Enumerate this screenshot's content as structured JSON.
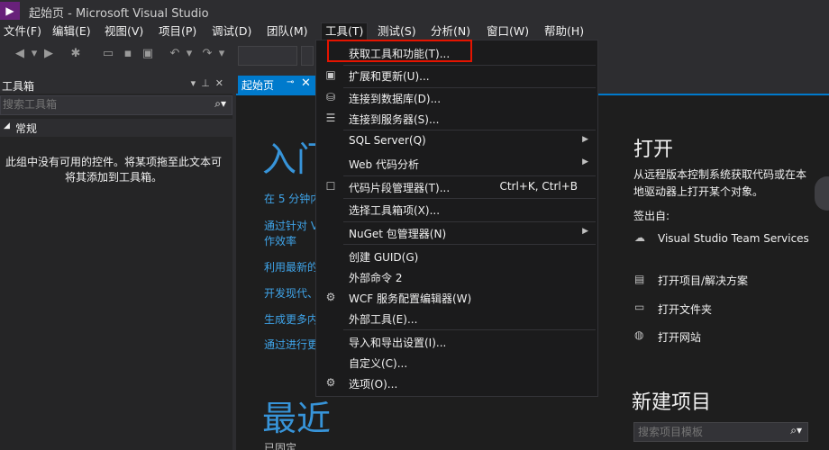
{
  "window": {
    "title": "起始页 - Microsoft Visual Studio",
    "logo": "vs-logo"
  },
  "menubar": [
    {
      "label": "文件(F)"
    },
    {
      "label": "编辑(E)"
    },
    {
      "label": "视图(V)"
    },
    {
      "label": "项目(P)"
    },
    {
      "label": "调试(D)"
    },
    {
      "label": "团队(M)"
    },
    {
      "label": "工具(T)"
    },
    {
      "label": "测试(S)"
    },
    {
      "label": "分析(N)"
    },
    {
      "label": "窗口(W)"
    },
    {
      "label": "帮助(H)"
    }
  ],
  "toolbox": {
    "title": "工具箱",
    "search_placeholder": "搜索工具箱",
    "group": "常规",
    "empty_text": "此组中没有可用的控件。将某项拖至此文本可将其添加到工具箱。"
  },
  "tab": {
    "label": "起始页"
  },
  "start_page": {
    "get_started_title": "入门",
    "links": [
      "在 5 分钟内",
      "通过针对 V",
      "作效率",
      "利用最新的",
      "开发现代、",
      "生成更多内",
      "通过进行更"
    ],
    "recent_title": "最近",
    "recent_partial": "已固定"
  },
  "right_panel": {
    "open_title": "打开",
    "open_desc": "从远程版本控制系统获取代码或在本地驱动器上打开某个对象。",
    "checkout_label": "签出自:",
    "team_services": "Visual Studio Team Services",
    "open_project": "打开项目/解决方案",
    "open_folder": "打开文件夹",
    "open_website": "打开网站",
    "new_project_title": "新建项目",
    "template_search_placeholder": "搜索项目模板"
  },
  "tools_menu": {
    "items": [
      {
        "label": "获取工具和功能(T)...",
        "icon": "",
        "shortcut": "",
        "submenu": false,
        "highlighted": true
      },
      {
        "label": "扩展和更新(U)...",
        "icon": "extensions-icon",
        "shortcut": "",
        "submenu": false
      },
      {
        "label": "连接到数据库(D)...",
        "icon": "database-connect-icon",
        "shortcut": "",
        "submenu": false
      },
      {
        "label": "连接到服务器(S)...",
        "icon": "server-connect-icon",
        "shortcut": "",
        "submenu": false
      },
      {
        "label": "SQL Server(Q)",
        "icon": "",
        "shortcut": "",
        "submenu": true
      },
      {
        "label": "Web 代码分析",
        "icon": "",
        "shortcut": "",
        "submenu": true
      },
      {
        "label": "代码片段管理器(T)...",
        "icon": "checkbox-icon",
        "shortcut": "Ctrl+K, Ctrl+B",
        "submenu": false
      },
      {
        "label": "选择工具箱项(X)...",
        "icon": "",
        "shortcut": "",
        "submenu": false
      },
      {
        "label": "NuGet 包管理器(N)",
        "icon": "",
        "shortcut": "",
        "submenu": true
      },
      {
        "label": "创建 GUID(G)",
        "icon": "",
        "shortcut": "",
        "submenu": false
      },
      {
        "label": "外部命令 2",
        "icon": "",
        "shortcut": "",
        "submenu": false
      },
      {
        "label": "WCF 服务配置编辑器(W)",
        "icon": "wcf-config-icon",
        "shortcut": "",
        "submenu": false
      },
      {
        "label": "外部工具(E)...",
        "icon": "",
        "shortcut": "",
        "submenu": false
      },
      {
        "label": "导入和导出设置(I)...",
        "icon": "",
        "shortcut": "",
        "submenu": false
      },
      {
        "label": "自定义(C)...",
        "icon": "",
        "shortcut": "",
        "submenu": false
      },
      {
        "label": "选项(O)...",
        "icon": "options-gear-icon",
        "shortcut": "",
        "submenu": false
      }
    ]
  },
  "colors": {
    "accent": "#007acc",
    "highlight_border": "#e51400",
    "link": "#3fa4e9"
  }
}
